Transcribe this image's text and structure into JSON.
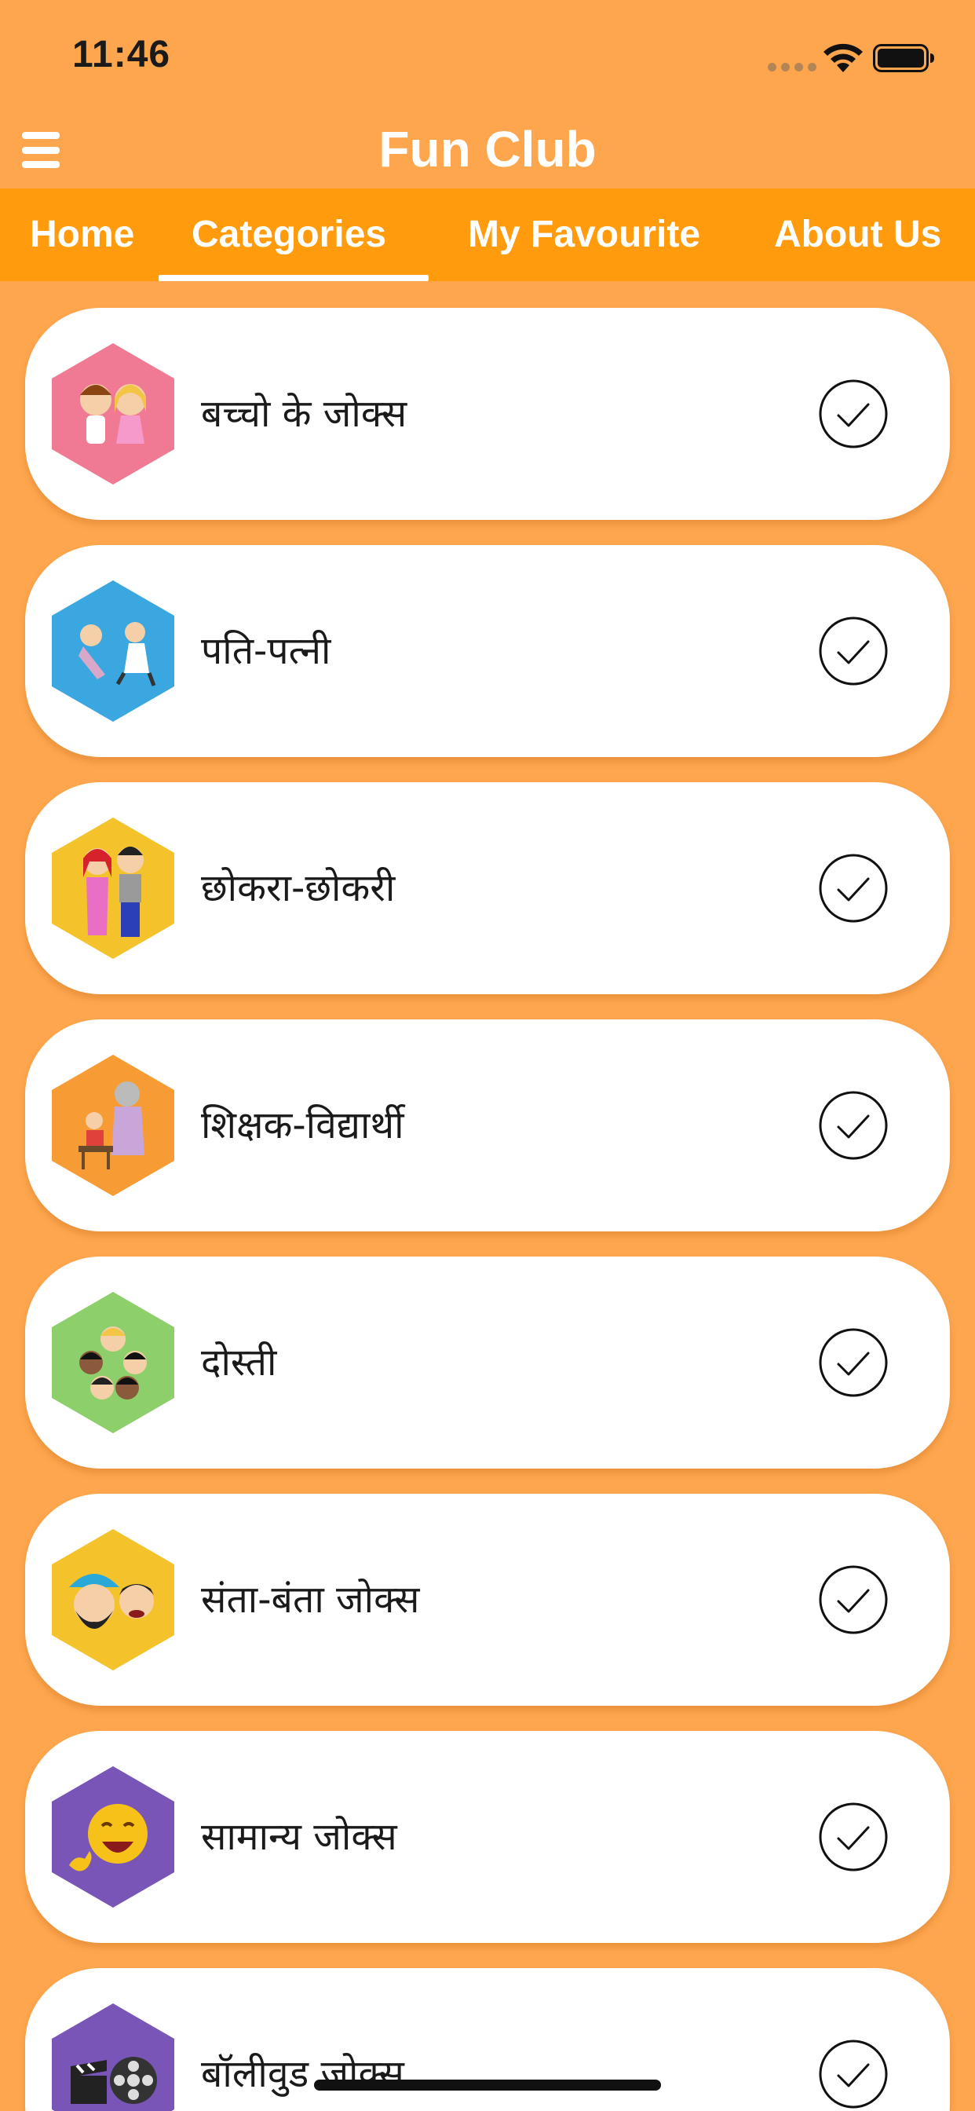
{
  "status_bar": {
    "time": "11:46"
  },
  "header": {
    "title": "Fun Club",
    "menu_icon": "hamburger-menu-icon"
  },
  "tabs": [
    {
      "label": "Home",
      "selected": false
    },
    {
      "label": "Categories",
      "selected": true
    },
    {
      "label": "My Favourite",
      "selected": false
    },
    {
      "label": "About Us",
      "selected": false
    }
  ],
  "categories": [
    {
      "label": "बच्चो के जोक्स",
      "icon": "kids-hexagon-icon",
      "hex_color": "#F07A94",
      "checked": true
    },
    {
      "label": "पति-पत्नी",
      "icon": "husband-wife-hexagon-icon",
      "hex_color": "#3AA7E0",
      "checked": true
    },
    {
      "label": "छोकरा-छोकरी",
      "icon": "boy-girl-hexagon-icon",
      "hex_color": "#F4C22B",
      "checked": true
    },
    {
      "label": "शिक्षक-विद्यार्थी",
      "icon": "teacher-student-hexagon-icon",
      "hex_color": "#F79C34",
      "checked": true
    },
    {
      "label": "दोस्ती",
      "icon": "friendship-hexagon-icon",
      "hex_color": "#8DD06B",
      "checked": true
    },
    {
      "label": "संता-बंता जोक्स",
      "icon": "santa-banta-hexagon-icon",
      "hex_color": "#F4C22B",
      "checked": true
    },
    {
      "label": "सामान्य जोक्स",
      "icon": "laughing-emoji-hexagon-icon",
      "hex_color": "#7A55B8",
      "checked": true
    },
    {
      "label": "बॉलीवुड जोक्स",
      "icon": "film-reel-hexagon-icon",
      "hex_color": "#7A55B8",
      "checked": true
    }
  ],
  "colors": {
    "background": "#FDA64E",
    "tab_bar": "#FF9B0C",
    "card": "#FFFFFF",
    "text": "#1A1A1A"
  }
}
